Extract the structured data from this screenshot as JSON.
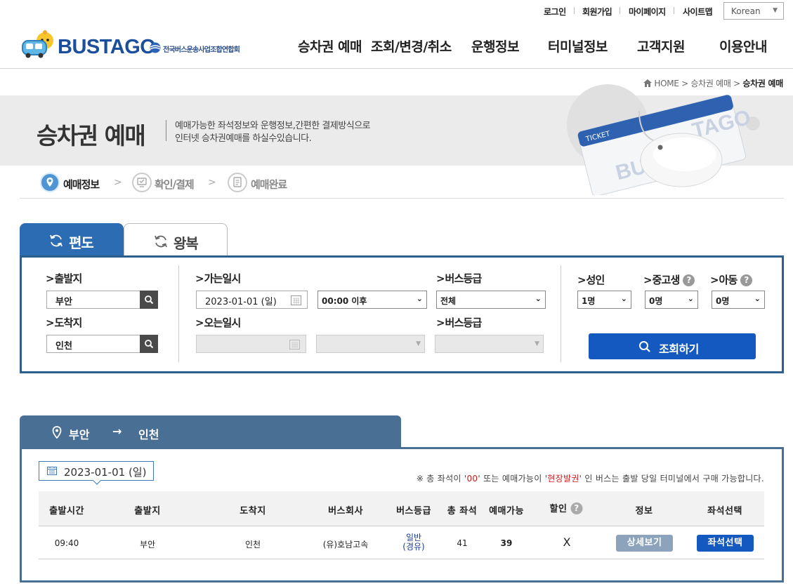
{
  "header": {
    "util_links": [
      "로그인",
      "회원가입",
      "마이페이지",
      "사이트맵"
    ],
    "language": "Korean",
    "logo_text": "BUSTAGO",
    "logo_sub": "전국버스운송사업조합연합회",
    "nav": [
      "승차권 예매",
      "조회/변경/취소",
      "운행정보",
      "터미널정보",
      "고객지원",
      "이용안내"
    ]
  },
  "breadcrumb": {
    "home": "HOME",
    "level1": "승차권 예매",
    "current": "승차권 예매"
  },
  "banner": {
    "title": "승차권 예매",
    "desc_line1": "예매가능한 좌석정보와 운행정보,간편한 결제방식으로",
    "desc_line2": "인터넷 승차권예매를 하실수있습니다.",
    "ticket_text": "TICKET",
    "ticket_brand_left": "BUS",
    "ticket_brand_right": "TAGO"
  },
  "steps": [
    "예매정보",
    "확인/결제",
    "예매완료"
  ],
  "tabs": {
    "one_way": "편도",
    "round_trip": "왕복"
  },
  "search": {
    "departure_label": "출발지",
    "departure_value": "부안",
    "arrival_label": "도착지",
    "arrival_value": "인천",
    "go_date_label": "가는일시",
    "go_date_value": "2023-01-01 (일)",
    "go_time_value": "00:00 이후",
    "bus_grade_label": "버스등급",
    "bus_grade_value": "전체",
    "return_date_label": "오는일시",
    "return_grade_label": "버스등급",
    "adult_label": "성인",
    "adult_value": "1명",
    "student_label": "중고생",
    "student_value": "0명",
    "child_label": "아동",
    "child_value": "0명",
    "search_button": "조회하기"
  },
  "result": {
    "route_from": "부안",
    "route_to": "인천",
    "date": "2023-01-01 (일)",
    "notice_pre": "※ 총 좌석이 '",
    "notice_zero": "00",
    "notice_mid": "' 또는 예매가능이 '",
    "notice_onsite": "현장발권",
    "notice_post": "' 인 버스는 출발 당일 터미널에서 구매 가능합니다.",
    "columns": [
      "출발시간",
      "출발지",
      "도착지",
      "버스회사",
      "버스등급",
      "총 좌석",
      "예매가능",
      "할인",
      "정보",
      "좌석선택"
    ],
    "rows": [
      {
        "time": "09:40",
        "from": "부안",
        "to": "인천",
        "company": "(유)호남고속",
        "grade_line1": "일반",
        "grade_line2": "(경유)",
        "total_seats": "41",
        "available": "39",
        "discount": "X",
        "detail_button": "상세보기",
        "seat_button": "좌석선택"
      }
    ]
  },
  "colors": {
    "primary": "#1359c0",
    "tab_active": "#2c6cb3",
    "route_bar": "#4a6f95",
    "notice_red": "#d21b1b"
  }
}
